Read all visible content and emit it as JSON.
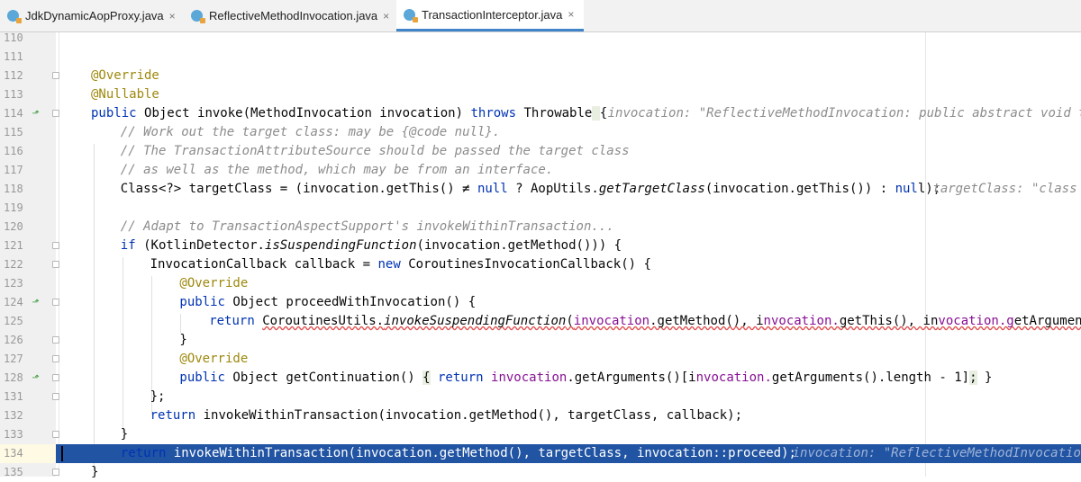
{
  "tabs": [
    {
      "label": "JdkDynamicAopProxy.java",
      "active": false
    },
    {
      "label": "ReflectiveMethodInvocation.java",
      "active": false
    },
    {
      "label": "TransactionInterceptor.java",
      "active": true
    }
  ],
  "close_glyph": "×",
  "editor": {
    "lines": [
      {
        "num": "110",
        "text": ""
      },
      {
        "num": "111",
        "text": ""
      },
      {
        "num": "112",
        "text": "@Override"
      },
      {
        "num": "113",
        "text": "@Nullable"
      },
      {
        "num": "114",
        "text": "public Object invoke(MethodInvocation invocation) throws Throwable {",
        "hint": "invocation: \"ReflectiveMethodInvocation: public abstract void top.po"
      },
      {
        "num": "115",
        "text": "// Work out the target class: may be {@code null}."
      },
      {
        "num": "116",
        "text": "// The TransactionAttributeSource should be passed the target class"
      },
      {
        "num": "117",
        "text": "// as well as the method, which may be from an interface."
      },
      {
        "num": "118",
        "text": "Class<?> targetClass = (invocation.getThis() ≠ null ? AopUtils.getTargetClass(invocation.getThis()) : null);",
        "hint": "targetClass: \"class top"
      },
      {
        "num": "119",
        "text": ""
      },
      {
        "num": "120",
        "text": "// Adapt to TransactionAspectSupport's invokeWithinTransaction..."
      },
      {
        "num": "121",
        "text": "if (KotlinDetector.isSuspendingFunction(invocation.getMethod())) {"
      },
      {
        "num": "122",
        "text": "InvocationCallback callback = new CoroutinesInvocationCallback() {"
      },
      {
        "num": "123",
        "text": "@Override"
      },
      {
        "num": "124",
        "text": "public Object proceedWithInvocation() {"
      },
      {
        "num": "125",
        "text": "return CoroutinesUtils.invokeSuspendingFunction(invocation.getMethod(), invocation.getThis(), invocation.getArguments());"
      },
      {
        "num": "126",
        "text": "}"
      },
      {
        "num": "127",
        "text": "@Override"
      },
      {
        "num": "128",
        "text": "public Object getContinuation() { return invocation.getArguments()[invocation.getArguments().length - 1]; }"
      },
      {
        "num": "131",
        "text": "};"
      },
      {
        "num": "132",
        "text": "return invokeWithinTransaction(invocation.getMethod(), targetClass, callback);"
      },
      {
        "num": "133",
        "text": "}"
      },
      {
        "num": "134",
        "text": "return invokeWithinTransaction(invocation.getMethod(), targetClass, invocation::proceed);",
        "hint": "invocation: \"ReflectiveMethodInvocation: pu",
        "highlighted": true
      },
      {
        "num": "135",
        "text": "}"
      }
    ]
  },
  "colors": {
    "keyword": "#0033b3",
    "annotation": "#9e880d",
    "comment": "#8c8c8c",
    "number": "#1750eb",
    "parameter": "#871094",
    "execution_line": "#2154a3",
    "active_tab_underline": "#4083c9"
  },
  "icons": {
    "file_tab": "java-class-file-icon",
    "gutter_marker": "override-method-marker-icon",
    "fold": "fold-toggle-icon"
  }
}
